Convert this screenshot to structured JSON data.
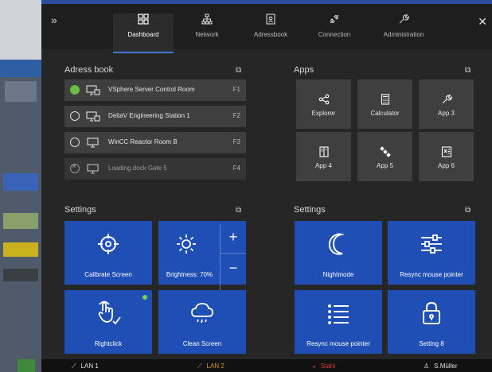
{
  "colors": {
    "accent": "#1f4fb5",
    "tab_active": "#3f79d6",
    "ok": "#6bbf45",
    "lan_warn": "#d39a1c",
    "alarm": "#d43a3a"
  },
  "tabs": [
    {
      "label": "Dashboard",
      "icon": "dashboard-icon",
      "active": true
    },
    {
      "label": "Network",
      "icon": "network-icon"
    },
    {
      "label": "Adressbook",
      "icon": "addressbook-icon"
    },
    {
      "label": "Connection",
      "icon": "connection-icon"
    },
    {
      "label": "Administration",
      "icon": "wrench-icon"
    }
  ],
  "address_book": {
    "title": "Adress book",
    "rows": [
      {
        "name": "VSphere Server Control Room",
        "key": "F1",
        "status": "connected"
      },
      {
        "name": "DeltaV Engineering Station 1",
        "key": "F2",
        "status": "idle"
      },
      {
        "name": "WinCC Reactor Room B",
        "key": "F3",
        "status": "idle"
      },
      {
        "name": "Loading dock Gate 5",
        "key": "F4",
        "status": "unavailable"
      }
    ]
  },
  "apps": {
    "title": "Apps",
    "items": [
      {
        "label": "Explorer",
        "icon": "share-icon"
      },
      {
        "label": "Calculator",
        "icon": "calculator-icon"
      },
      {
        "label": "App 3",
        "icon": "wrench-icon"
      },
      {
        "label": "App 4",
        "icon": "app-window-icon"
      },
      {
        "label": "App 5",
        "icon": "satellite-icon"
      },
      {
        "label": "App 6",
        "icon": "spreadsheet-icon"
      }
    ]
  },
  "settings_left": {
    "title": "Settings",
    "calibrate": "Calibrate Screen",
    "brightness": "Brightness: 70%",
    "brightness_level": 70,
    "plus": "+",
    "minus": "−",
    "rightclick": "Rightclick",
    "clean": "Clean Screen"
  },
  "settings_right": {
    "title": "Settings",
    "nightmode": "Nightmode",
    "resync1": "Resync mouse pointer",
    "resync2": "Resync mouse pointer",
    "setting8": "Setting 8"
  },
  "statusbar": {
    "lan1": "LAN 1",
    "lan2": "LAN 2",
    "alarm": "Stahl",
    "user": "S.Müller"
  }
}
